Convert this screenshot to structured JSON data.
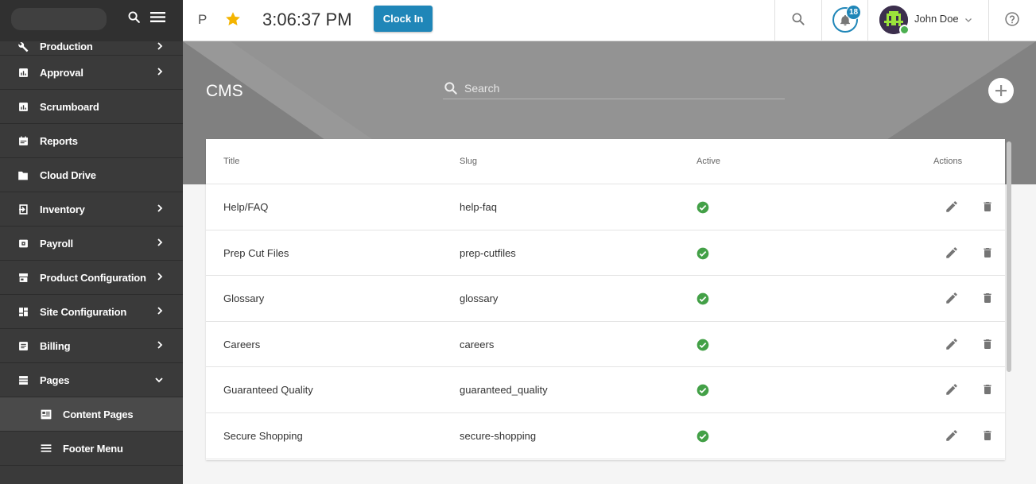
{
  "sidebar": {
    "items": [
      {
        "label": "Production",
        "icon": "wrench-icon",
        "expandable": true
      },
      {
        "label": "Approval",
        "icon": "chart-icon",
        "expandable": true
      },
      {
        "label": "Scrumboard",
        "icon": "chart-icon",
        "expandable": false
      },
      {
        "label": "Reports",
        "icon": "calendar-icon",
        "expandable": false
      },
      {
        "label": "Cloud Drive",
        "icon": "folder-icon",
        "expandable": false
      },
      {
        "label": "Inventory",
        "icon": "login-icon",
        "expandable": true
      },
      {
        "label": "Payroll",
        "icon": "wallet-icon",
        "expandable": true
      },
      {
        "label": "Product Configuration",
        "icon": "store-icon",
        "expandable": true
      },
      {
        "label": "Site Configuration",
        "icon": "dashboard-icon",
        "expandable": true
      },
      {
        "label": "Billing",
        "icon": "list-icon",
        "expandable": true
      },
      {
        "label": "Pages",
        "icon": "pages-icon",
        "expandable": true,
        "expanded": true
      }
    ],
    "sub_items": [
      {
        "label": "Content Pages",
        "icon": "content-icon",
        "active": true
      },
      {
        "label": "Footer Menu",
        "icon": "menu-icon",
        "active": false
      }
    ]
  },
  "topbar": {
    "p_label": "P",
    "time": "3:06:37 PM",
    "clock_in_label": "Clock In",
    "notification_count": "18",
    "user_name": "John Doe"
  },
  "page": {
    "title": "CMS",
    "search_placeholder": "Search"
  },
  "table": {
    "headers": {
      "title": "Title",
      "slug": "Slug",
      "active": "Active",
      "actions": "Actions"
    },
    "rows": [
      {
        "title": "Help/FAQ",
        "slug": "help-faq",
        "active": true
      },
      {
        "title": "Prep Cut Files",
        "slug": "prep-cutfiles",
        "active": true
      },
      {
        "title": "Glossary",
        "slug": "glossary",
        "active": true
      },
      {
        "title": "Careers",
        "slug": "careers",
        "active": true
      },
      {
        "title": "Guaranteed Quality",
        "slug": "guaranteed_quality",
        "active": true
      },
      {
        "title": "Secure Shopping",
        "slug": "secure-shopping",
        "active": true
      }
    ]
  },
  "colors": {
    "sidebar_bg": "#3a3a3a",
    "accent": "#1f86b8",
    "hero_bg": "#8e8e8e",
    "active_check": "#43a047"
  }
}
